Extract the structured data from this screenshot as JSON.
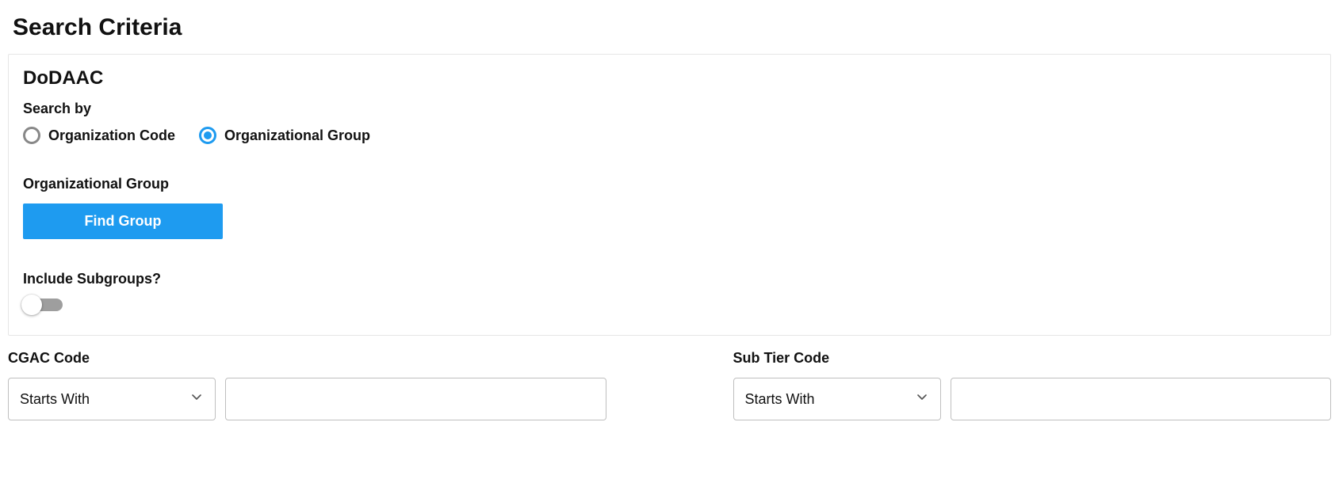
{
  "page": {
    "title": "Search Criteria"
  },
  "panel": {
    "title": "DoDAAC",
    "search_by_label": "Search by",
    "radios": {
      "org_code": "Organization Code",
      "org_group": "Organizational Group",
      "selected": "org_group"
    },
    "org_group_label": "Organizational Group",
    "find_group_button": "Find Group",
    "include_subgroups_label": "Include Subgroups?",
    "include_subgroups_value": false
  },
  "filters": {
    "cgac": {
      "label": "CGAC Code",
      "operator": "Starts With",
      "value": ""
    },
    "subtier": {
      "label": "Sub Tier Code",
      "operator": "Starts With",
      "value": ""
    }
  }
}
